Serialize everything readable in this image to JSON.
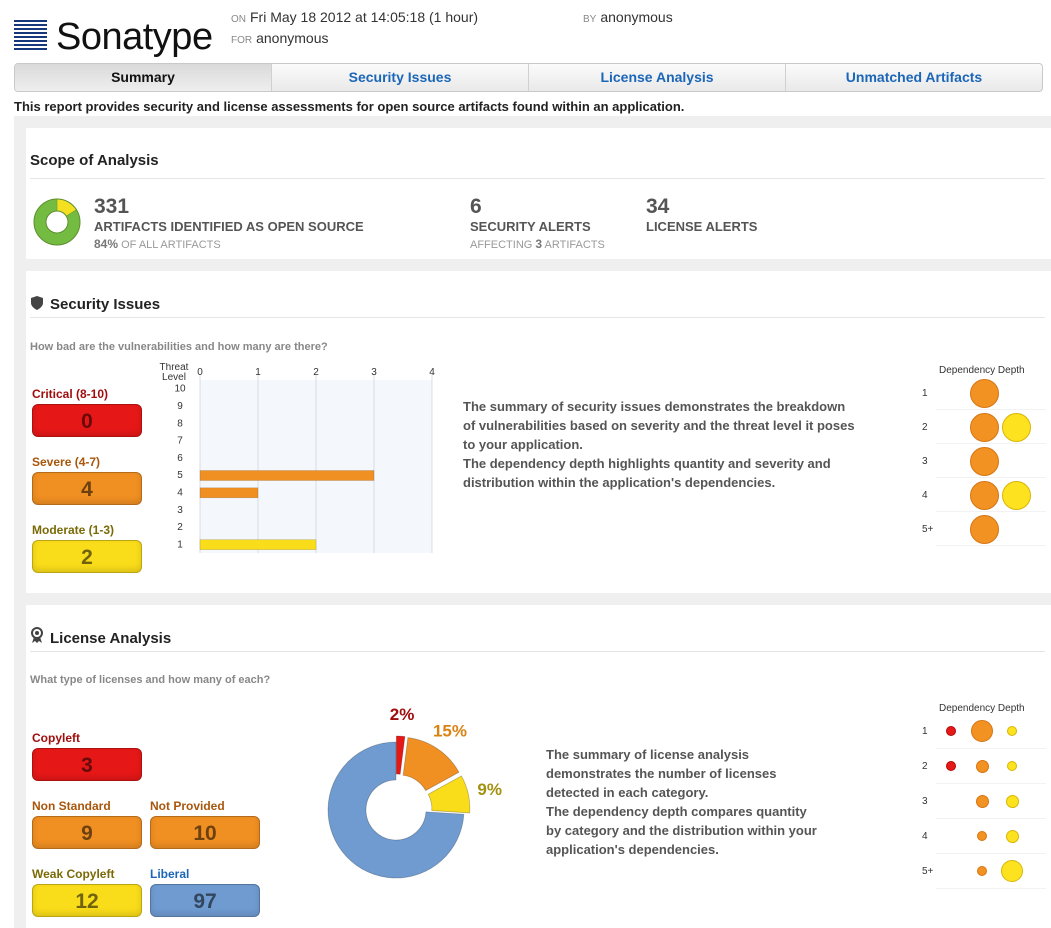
{
  "header": {
    "logo_text": "Sonatype",
    "on_label": "ON",
    "date": "Fri May 18 2012 at 14:05:18 (1 hour)",
    "for_label": "FOR",
    "for_value": "anonymous",
    "by_label": "BY",
    "by_value": "anonymous"
  },
  "tabs": [
    "Summary",
    "Security Issues",
    "License Analysis",
    "Unmatched Artifacts"
  ],
  "active_tab": "Summary",
  "intro": "This report provides security and license assessments for open source artifacts found within an application.",
  "scope": {
    "title": "Scope of Analysis",
    "artifacts_count": "331",
    "artifacts_label": "ARTIFACTS IDENTIFIED AS OPEN SOURCE",
    "artifacts_pct": "84%",
    "artifacts_pct_suffix": "OF ALL ARTIFACTS",
    "artifacts_fraction": 0.84,
    "security_count": "6",
    "security_label": "SECURITY ALERTS",
    "security_sub_prefix": "AFFECTING",
    "security_sub_num": "3",
    "security_sub_suffix": "ARTIFACTS",
    "license_count": "34",
    "license_label": "LICENSE ALERTS"
  },
  "security": {
    "title": "Security Issues",
    "question": "How bad are the vulnerabilities and how many are there?",
    "levels": [
      {
        "label": "Critical (8-10)",
        "value": "0",
        "color": "#e61717",
        "label_color": "#a10d0d"
      },
      {
        "label": "Severe (4-7)",
        "value": "4",
        "color": "#f08f22",
        "label_color": "#a8560b"
      },
      {
        "label": "Moderate (1-3)",
        "value": "2",
        "color": "#f9dc1a",
        "label_color": "#7a6a06"
      }
    ],
    "description": [
      "The summary of security issues demonstrates the breakdown",
      "of vulnerabilities based on severity and the threat level it poses",
      "to your application.",
      "The dependency depth highlights quantity and severity and",
      "distribution within the application's dependencies."
    ],
    "dependency_title": "Dependency Depth",
    "depth_rows": [
      "1",
      "2",
      "3",
      "4",
      "5+"
    ],
    "dep_orange": [
      1,
      1,
      1,
      1,
      1
    ],
    "dep_yellow": [
      0,
      1,
      0,
      1,
      0
    ]
  },
  "threat_chart": {
    "chart_data": {
      "type": "bar",
      "ylabel": "Threat Level",
      "y_ticks": [
        "10",
        "9",
        "8",
        "7",
        "6",
        "5",
        "4",
        "3",
        "2",
        "1"
      ],
      "x_ticks": [
        "0",
        "1",
        "2",
        "3",
        "4"
      ],
      "xlim": [
        0,
        4
      ],
      "series": [
        {
          "level": 5,
          "value": 3,
          "color": "#f08f22"
        },
        {
          "level": 4,
          "value": 1,
          "color": "#f08f22"
        },
        {
          "level": 1,
          "value": 2,
          "color": "#f9dc1a"
        }
      ]
    }
  },
  "license": {
    "title": "License Analysis",
    "question": "What type of licenses and how many of each?",
    "categories": [
      {
        "label": "Copyleft",
        "value": "3",
        "color": "#e61717",
        "label_color": "#a10d0d"
      },
      {
        "label": "Non Standard",
        "value": "9",
        "color": "#f08f22",
        "label_color": "#a8560b"
      },
      {
        "label": "Not Provided",
        "value": "10",
        "color": "#f08f22",
        "label_color": "#a8560b"
      },
      {
        "label": "Weak Copyleft",
        "value": "12",
        "color": "#f9dc1a",
        "label_color": "#7a6a06"
      },
      {
        "label": "Liberal",
        "value": "97",
        "color": "#6f9bd1",
        "label_color": "#1b66b8"
      }
    ],
    "description": [
      "The summary of license analysis",
      "demonstrates the number of licenses",
      "detected in each category.",
      "The dependency depth compares quantity",
      "by category and the distribution within your",
      "application's dependencies."
    ],
    "dependency_title": "Dependency Depth",
    "depth_rows": [
      "1",
      "2",
      "3",
      "4",
      "5+"
    ],
    "dep_red": [
      1,
      1,
      0,
      0,
      0
    ],
    "dep_orange": [
      3,
      2,
      2,
      1,
      1
    ],
    "dep_yellow": [
      1,
      1,
      2,
      2,
      3
    ],
    "chart_data": {
      "type": "pie",
      "slices": [
        {
          "label": "2%",
          "value": 2,
          "color": "#e61717"
        },
        {
          "label": "15%",
          "value": 15,
          "color": "#f08f22"
        },
        {
          "label": "9%",
          "value": 9,
          "color": "#f9dc1a"
        },
        {
          "label": "",
          "value": 74,
          "color": "#6f9bd1"
        }
      ]
    }
  }
}
